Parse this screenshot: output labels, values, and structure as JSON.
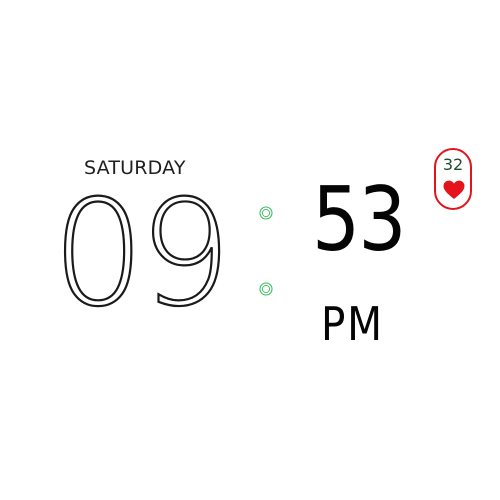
{
  "watchface": {
    "day_of_week": "SATURDAY",
    "hours": "09",
    "minutes": "53",
    "ampm": "PM"
  },
  "heart_rate": {
    "value": "32",
    "icon": "heart-icon"
  },
  "colors": {
    "background": "#ffffff",
    "digits": "#050505",
    "colon_dots": "#3bbf5a",
    "heart_accent": "#e3141b"
  }
}
